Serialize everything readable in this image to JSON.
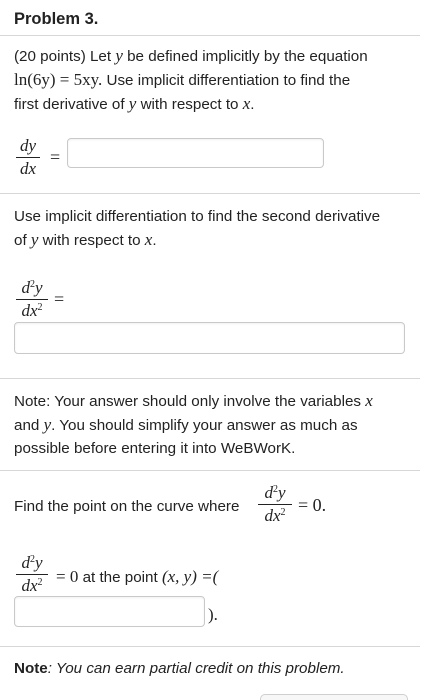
{
  "problem": {
    "title": "Problem 3.",
    "intro_prefix": "(20 points) Let ",
    "intro_var_y": "y",
    "intro_suffix": " be defined implicitly by the equation",
    "equation_lhs": "ln(6y)",
    "equation_rhs": "= 5xy.",
    "intro_line2_suffix": " Use implicit differentiation to find the",
    "intro_line3_prefix": "first derivative of ",
    "intro_line3_var_y": "y",
    "intro_line3_mid": " with respect to ",
    "intro_line3_var_x": "x",
    "intro_line3_end": "."
  },
  "first_derivative": {
    "numerator": "dy",
    "denominator": "dx",
    "equals": "=",
    "answer_value": ""
  },
  "second_intro": {
    "line1": "Use implicit differentiation to find the second derivative",
    "line2_prefix": "of ",
    "line2_var_y": "y",
    "line2_mid": " with respect to ",
    "line2_var_x": "x",
    "line2_end": "."
  },
  "second_derivative": {
    "numerator_d": "d",
    "numerator_exp": "2",
    "numerator_y": "y",
    "denominator_dx": "dx",
    "denominator_exp": "2",
    "equals": "=",
    "answer_value": ""
  },
  "note": {
    "line1_prefix": "Note: Your answer should only involve the variables ",
    "line1_var_x": "x",
    "line2_prefix": "and ",
    "line2_var_y": "y",
    "line2_suffix": ". You should simplify your answer as much as",
    "line3": "possible before entering it into WeBWorK."
  },
  "find_point": {
    "text": "Find the point on the curve where",
    "numerator_d": "d",
    "numerator_exp": "2",
    "numerator_y": "y",
    "denominator_dx": "dx",
    "denominator_exp": "2",
    "equals_zero": "= 0."
  },
  "point_answer": {
    "numerator_d": "d",
    "numerator_exp": "2",
    "numerator_y": "y",
    "denominator_dx": "dx",
    "denominator_exp": "2",
    "eq_zero": "= 0",
    "at_the_point": " at the point ",
    "point_expr": "(x, y) =(",
    "answer_value": "",
    "closing": ")."
  },
  "partial_credit": {
    "label": "Note",
    "text": ": You can earn partial credit on this problem."
  }
}
